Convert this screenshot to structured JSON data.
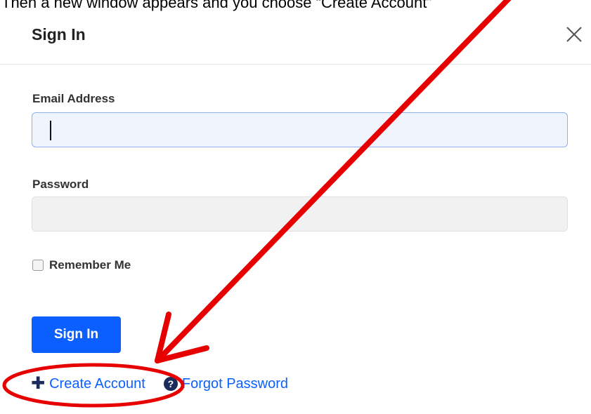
{
  "caption": "Then a new window appears and you choose “Create Account”",
  "modal": {
    "title": "Sign In",
    "close_icon": "close-icon"
  },
  "form": {
    "email_label": "Email Address",
    "email_value": "",
    "password_label": "Password",
    "password_value": "",
    "remember_label": "Remember Me",
    "submit_label": "Sign In"
  },
  "links": {
    "create_account": "Create Account",
    "create_account_icon": "plus-icon",
    "forgot_password": "Forgot Password",
    "forgot_password_icon": "question-circle-icon",
    "help_glyph": "?"
  },
  "colors": {
    "primary": "#0b5fff",
    "annotation": "#e60000",
    "icon": "#1a2b5c"
  }
}
